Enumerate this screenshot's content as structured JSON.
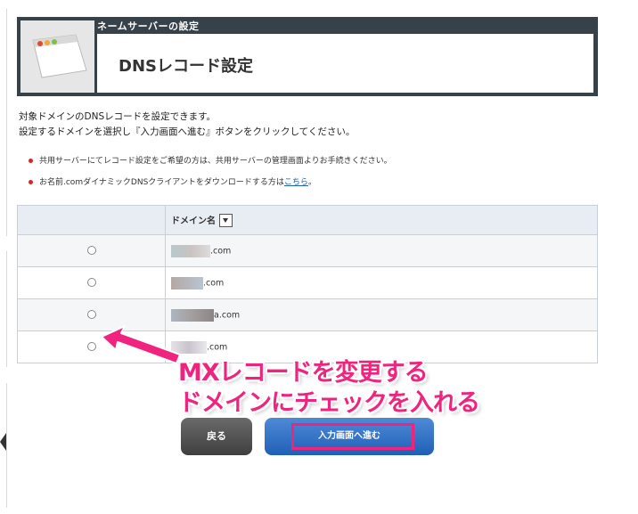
{
  "header": {
    "section_label": "ネームサーバーの設定",
    "title": "DNSレコード設定",
    "icon": "browser-window-icon"
  },
  "intro": {
    "line1": "対象ドメインのDNSレコードを設定できます。",
    "line2": "設定するドメインを選択し『入力画面へ進む』ボタンをクリックしてください。"
  },
  "notes": [
    {
      "text": "共用サーバーにてレコード設定をご希望の方は、共用サーバーの管理画面よりお手続きください。"
    },
    {
      "text": "お名前.comダイナミックDNSクライアントをダウンロードする方は",
      "link": "こちら",
      "suffix": "。"
    }
  ],
  "table": {
    "header_domain": "ドメイン名",
    "rows": [
      {
        "suffix": ".com",
        "selected": false
      },
      {
        "suffix": ".com",
        "selected": false
      },
      {
        "suffix": "a.com",
        "selected": false
      },
      {
        "suffix": ".com",
        "selected": false
      }
    ]
  },
  "callout": {
    "line1": "MXレコードを変更する",
    "line2": "ドメインにチェックを入れる"
  },
  "buttons": {
    "back": "戻る",
    "next": "入力画面へ進む"
  },
  "colors": {
    "accent_pink": "#f0247e",
    "header_dark": "#37414a",
    "next_blue": "#2a6cc4"
  }
}
